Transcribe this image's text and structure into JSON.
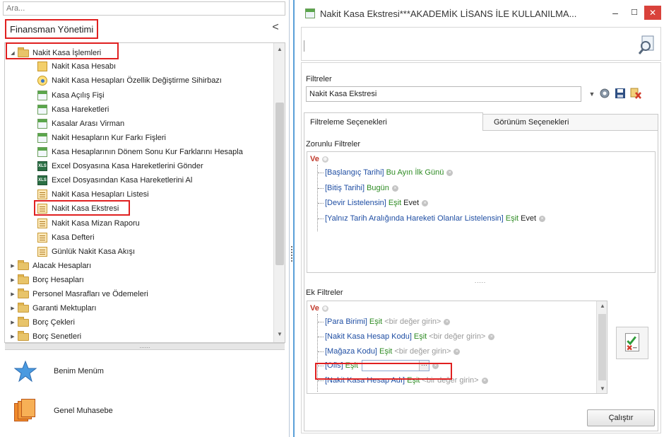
{
  "search": {
    "placeholder": "Ara..."
  },
  "left_panel": {
    "title": "Finansman Yönetimi",
    "collapse_glyph": "<",
    "tree": [
      {
        "label": "Nakit Kasa İşlemleri",
        "type": "folder-open",
        "icon": "folder-icon",
        "highlighted": true
      },
      {
        "label": "Nakit Kasa Hesabı",
        "type": "item",
        "icon": "account-card-icon"
      },
      {
        "label": "Nakit Kasa Hesapları Özellik Değiştirme Sihirbazı",
        "type": "item",
        "icon": "wizard-icon"
      },
      {
        "label": "Kasa Açılış Fişi",
        "type": "item",
        "icon": "form-icon"
      },
      {
        "label": "Kasa Hareketleri",
        "type": "item",
        "icon": "form-icon"
      },
      {
        "label": "Kasalar Arası Virman",
        "type": "item",
        "icon": "form-icon"
      },
      {
        "label": "Nakit Hesapların Kur Farkı Fişleri",
        "type": "item",
        "icon": "form-icon"
      },
      {
        "label": "Kasa Hesaplarının Dönem Sonu Kur Farklarını Hesapla",
        "type": "item",
        "icon": "form-icon"
      },
      {
        "label": "Excel Dosyasına Kasa Hareketlerini Gönder",
        "type": "item",
        "icon": "excel-export-icon"
      },
      {
        "label": "Excel Dosyasından Kasa Hareketlerini Al",
        "type": "item",
        "icon": "excel-import-icon"
      },
      {
        "label": "Nakit Kasa Hesapları Listesi",
        "type": "item",
        "icon": "report-icon"
      },
      {
        "label": "Nakit Kasa Ekstresi",
        "type": "item",
        "icon": "report-icon",
        "highlighted": true
      },
      {
        "label": "Nakit Kasa Mizan Raporu",
        "type": "item",
        "icon": "report-icon"
      },
      {
        "label": "Kasa Defteri",
        "type": "item",
        "icon": "report-icon"
      },
      {
        "label": "Günlük Nakit Kasa Akışı",
        "type": "item",
        "icon": "report-icon"
      },
      {
        "label": "Alacak Hesapları",
        "type": "folder",
        "icon": "folder-icon"
      },
      {
        "label": "Borç Hesapları",
        "type": "folder",
        "icon": "folder-icon"
      },
      {
        "label": "Personel Masrafları ve Ödemeleri",
        "type": "folder",
        "icon": "folder-icon"
      },
      {
        "label": "Garanti Mektupları",
        "type": "folder",
        "icon": "folder-icon"
      },
      {
        "label": "Borç Çekleri",
        "type": "folder",
        "icon": "folder-icon"
      },
      {
        "label": "Borç Senetleri",
        "type": "folder",
        "icon": "folder-icon"
      }
    ],
    "splitter_dots": "......",
    "bottom": [
      {
        "label": "Benim Menüm",
        "icon": "star-icon"
      },
      {
        "label": "Genel Muhasebe",
        "icon": "books-icon"
      }
    ]
  },
  "window": {
    "title": "Nakit Kasa Ekstresi***AKADEMİK LİSANS İLE KULLANILMA...",
    "minimize": "–",
    "maximize": "☐",
    "close": "✕",
    "filters_label": "Filtreler",
    "filter_combo_value": "Nakit Kasa Ekstresi",
    "tabs": [
      "Filtreleme Seçenekleri",
      "Görünüm Seçenekleri"
    ],
    "required_label": "Zorunlu Filtreler",
    "ve": "Ve",
    "required": [
      {
        "field": "[Başlangıç Tarihi]",
        "op": "Bu Ayın İlk Günü",
        "value": "",
        "value_style": "green"
      },
      {
        "field": "[Bitiş Tarihi]",
        "op": "Bugün",
        "value": "",
        "value_style": "green"
      },
      {
        "field": "[Devir Listelensin]",
        "op": "Eşit",
        "value": "Evet",
        "value_style": "plain"
      },
      {
        "field": "[Yalnız Tarih Aralığında Hareketi Olanlar Listelensin]",
        "op": "Eşit",
        "value": "Evet",
        "value_style": "plain"
      }
    ],
    "mid_dots": ".....",
    "extra_label": "Ek Filtreler",
    "extra": [
      {
        "field": "[Para Birimi]",
        "op": "Eşit",
        "placeholder": "<bir değer girin>"
      },
      {
        "field": "[Nakit Kasa Hesap Kodu]",
        "op": "Eşit",
        "placeholder": "<bir değer girin>"
      },
      {
        "field": "[Mağaza Kodu]",
        "op": "Eşit",
        "placeholder": "<bir değer girin>"
      },
      {
        "field": "[Ofis]",
        "op": "Eşit",
        "placeholder": "",
        "editing": true
      },
      {
        "field": "[Nakit Kasa Hesap Adı]",
        "op": "Eşit",
        "placeholder": "<bir değer girin>"
      }
    ],
    "ellipsis": "···",
    "run_button": "Çalıştır"
  },
  "colors": {
    "highlight_red": "#e02020",
    "field_blue": "#1f4ea3",
    "op_green": "#2e8b23",
    "ve_red": "#c0392b",
    "close_red": "#d9423b"
  }
}
